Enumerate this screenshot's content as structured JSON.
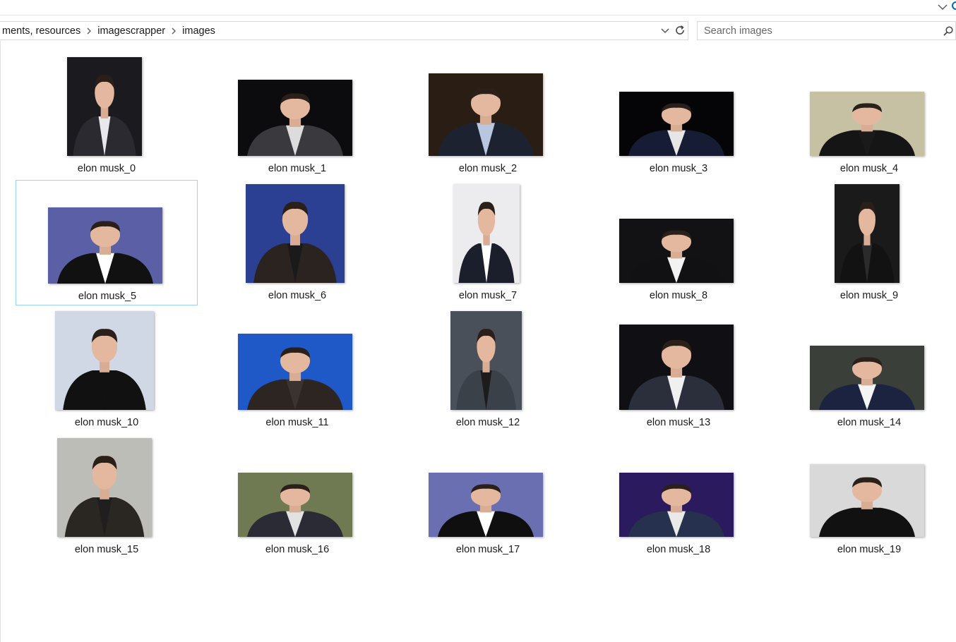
{
  "address": {
    "crumbs": [
      "ments, resources",
      "imagescrapper",
      "images"
    ]
  },
  "search": {
    "placeholder": "Search images"
  },
  "colors": {
    "selection_border": "#99d1ff",
    "accent": "#0067c0"
  },
  "icons": {
    "crumb_separator": "chevron-right-icon",
    "address_dropdown": "chevron-down-icon",
    "refresh": "refresh-icon",
    "search": "search-icon"
  },
  "files": [
    {
      "name": "elon musk_0",
      "selected": false
    },
    {
      "name": "elon musk_1",
      "selected": false
    },
    {
      "name": "elon musk_2",
      "selected": false
    },
    {
      "name": "elon musk_3",
      "selected": false
    },
    {
      "name": "elon musk_4",
      "selected": false
    },
    {
      "name": "elon musk_5",
      "selected": true
    },
    {
      "name": "elon musk_6",
      "selected": false
    },
    {
      "name": "elon musk_7",
      "selected": false
    },
    {
      "name": "elon musk_8",
      "selected": false
    },
    {
      "name": "elon musk_9",
      "selected": false
    },
    {
      "name": "elon musk_10",
      "selected": false
    },
    {
      "name": "elon musk_11",
      "selected": false
    },
    {
      "name": "elon musk_12",
      "selected": false
    },
    {
      "name": "elon musk_13",
      "selected": false
    },
    {
      "name": "elon musk_14",
      "selected": false
    },
    {
      "name": "elon musk_15",
      "selected": false
    },
    {
      "name": "elon musk_16",
      "selected": false
    },
    {
      "name": "elon musk_17",
      "selected": false
    },
    {
      "name": "elon musk_18",
      "selected": false
    },
    {
      "name": "elon musk_19",
      "selected": false
    }
  ]
}
